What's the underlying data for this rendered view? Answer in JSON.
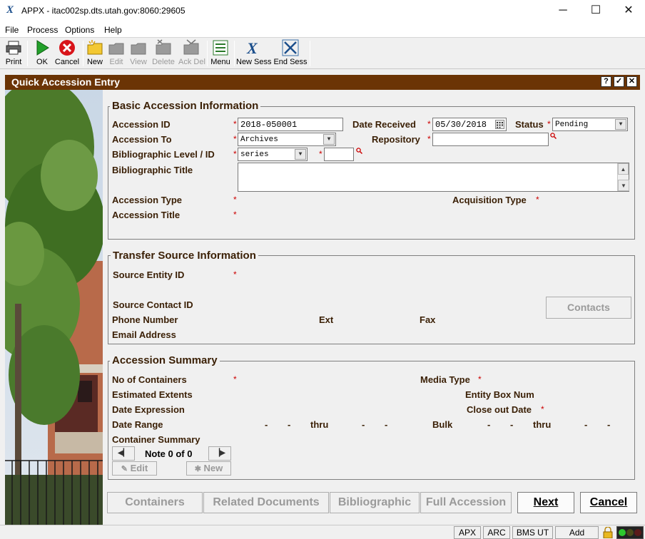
{
  "window": {
    "title": "APPX - itac002sp.dts.utah.gov:8060:29605",
    "app_icon": "X"
  },
  "menu": [
    "File",
    "Process",
    "Options",
    "Help"
  ],
  "toolbar": {
    "print": "Print",
    "ok": "OK",
    "cancel": "Cancel",
    "new": "New",
    "edit": "Edit",
    "view": "View",
    "delete": "Delete",
    "ack_del": "Ack Del",
    "menu": "Menu",
    "new_sess": "New Sess",
    "end_sess": "End Sess"
  },
  "dialog": {
    "title": "Quick Accession Entry",
    "help_btn": "?",
    "check_btn": "✓",
    "close_btn": "✕"
  },
  "basic": {
    "group_title": "Basic Accession Information",
    "accession_id_label": "Accession ID",
    "accession_id_value": "2018-050001",
    "date_received_label": "Date Received",
    "date_received_value": "05/30/2018",
    "status_label": "Status",
    "status_value": "Pending",
    "accession_to_label": "Accession To",
    "accession_to_value": "Archives",
    "repository_label": "Repository",
    "repository_value": "",
    "bib_level_label": "Bibliographic Level / ID",
    "bib_level_value": "series",
    "bib_id_value": "",
    "bib_title_label": "Bibliographic Title",
    "bib_title_value": "",
    "accession_type_label": "Accession Type",
    "acquisition_type_label": "Acquisition Type",
    "accession_title_label": "Accession Title"
  },
  "transfer": {
    "group_title": "Transfer Source Information",
    "source_entity_label": "Source Entity ID",
    "source_contact_label": "Source Contact ID",
    "phone_label": "Phone Number",
    "ext_label": "Ext",
    "fax_label": "Fax",
    "email_label": "Email Address",
    "contacts_button": "Contacts"
  },
  "summary": {
    "group_title": "Accession Summary",
    "containers_label": "No of Containers",
    "media_type_label": "Media Type",
    "est_extents_label": "Estimated Extents",
    "entity_box_label": "Entity Box Num",
    "date_expr_label": "Date Expression",
    "close_out_label": "Close out Date",
    "date_range_label": "Date Range",
    "thru_label": "thru",
    "bulk_label": "Bulk",
    "dash": "-",
    "container_summary_label": "Container Summary",
    "note_counter": "Note 0 of 0",
    "edit_button": "Edit",
    "new_button": "New"
  },
  "footer": {
    "containers": "Containers",
    "related_documents": "Related Documents",
    "bibliographic": "Bibliographic",
    "full_accession": "Full Accession",
    "next": "Next",
    "cancel": "Cancel"
  },
  "status": {
    "apx": "APX",
    "arc": "ARC",
    "bms": "BMS UT",
    "mode": "Add"
  },
  "colors": {
    "header": "#6b3405",
    "label": "#3a1f05",
    "required": "#cc0000"
  }
}
